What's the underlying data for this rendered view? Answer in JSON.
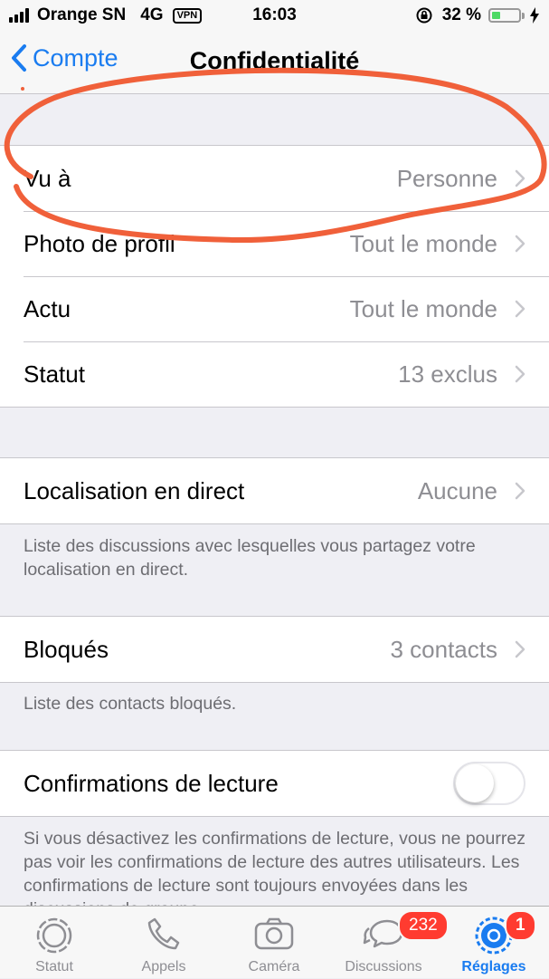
{
  "status_bar": {
    "carrier": "Orange SN",
    "network": "4G",
    "vpn": "VPN",
    "time": "16:03",
    "battery_percent": "32 %",
    "battery_level": 0.32
  },
  "nav": {
    "back_label": "Compte",
    "title": "Confidentialité"
  },
  "section1": [
    {
      "label": "Vu à",
      "value": "Personne"
    },
    {
      "label": "Photo de profil",
      "value": "Tout le monde"
    },
    {
      "label": "Actu",
      "value": "Tout le monde"
    },
    {
      "label": "Statut",
      "value": "13 exclus"
    }
  ],
  "live_location": {
    "label": "Localisation en direct",
    "value": "Aucune",
    "footer": "Liste des discussions avec lesquelles vous partagez votre localisation en direct."
  },
  "blocked": {
    "label": "Bloqués",
    "value": "3 contacts",
    "footer": "Liste des contacts bloqués."
  },
  "read_receipts": {
    "label": "Confirmations de lecture",
    "enabled": false,
    "footer": "Si vous désactivez les confirmations de lecture, vous ne pourrez pas voir les confirmations de lecture des autres utilisateurs. Les confirmations de lecture sont toujours envoyées dans les discussions de groupe."
  },
  "tabs": [
    {
      "label": "Statut",
      "icon": "status-icon"
    },
    {
      "label": "Appels",
      "icon": "phone-icon"
    },
    {
      "label": "Caméra",
      "icon": "camera-icon"
    },
    {
      "label": "Discussions",
      "icon": "chat-icon",
      "badge": "232"
    },
    {
      "label": "Réglages",
      "icon": "gear-icon",
      "badge": "1",
      "active": true
    }
  ],
  "colors": {
    "accent": "#1a7cf0",
    "annotation": "#f0603a",
    "badge": "#ff3b30"
  }
}
